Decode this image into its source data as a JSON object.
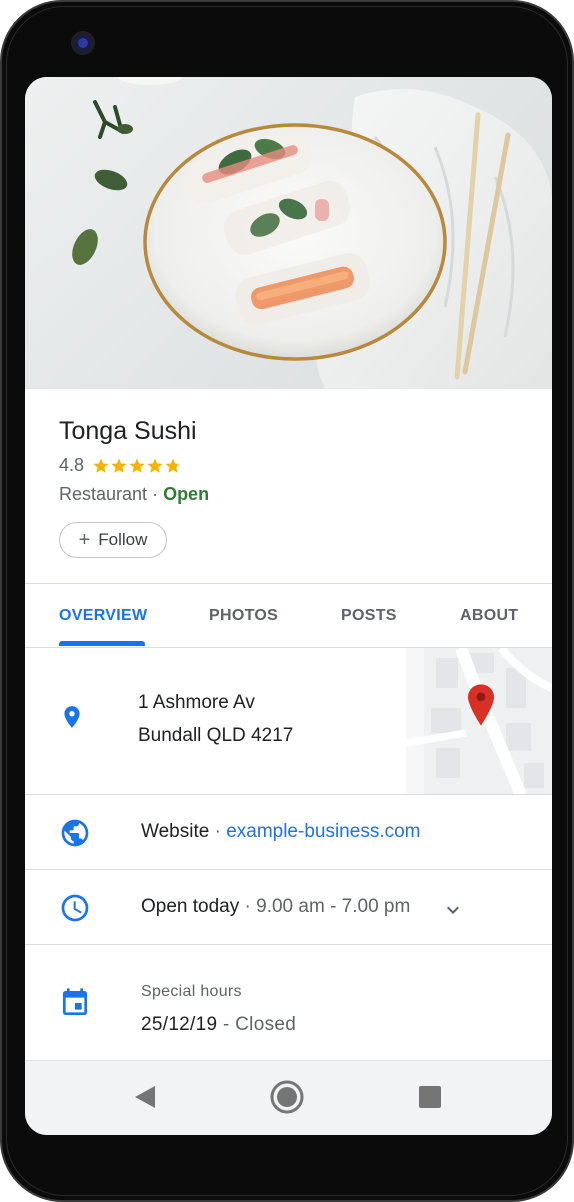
{
  "business": {
    "name": "Tonga Sushi",
    "rating": "4.8",
    "stars_filled": 4.8,
    "category": "Restaurant",
    "separator": " · ",
    "status": "Open",
    "follow_label": "Follow"
  },
  "tabs": [
    {
      "label": "OVERVIEW",
      "active": true
    },
    {
      "label": "PHOTOS",
      "active": false
    },
    {
      "label": "POSTS",
      "active": false
    },
    {
      "label": "ABOUT",
      "active": false
    }
  ],
  "address": {
    "line1": "1 Ashmore Av",
    "line2": "Bundall QLD 4217"
  },
  "website": {
    "label": "Website",
    "separator": " · ",
    "url": "example-business.com"
  },
  "hours": {
    "label": "Open today",
    "separator": " · ",
    "range": "9.00 am - 7.00 pm"
  },
  "special_hours": {
    "label": "Special hours",
    "date": "25/12/19",
    "separator": " - ",
    "status": "Closed"
  },
  "colors": {
    "accent": "#1a73e8",
    "open_green": "#2e7d32",
    "star": "#f4b400",
    "map_pin": "#d93025"
  },
  "icons": {
    "address": "location-pin-icon",
    "website": "globe-icon",
    "hours": "clock-icon",
    "special": "calendar-icon",
    "nav_back": "back-triangle-icon",
    "nav_home": "home-circle-icon",
    "nav_recents": "recents-square-icon"
  }
}
